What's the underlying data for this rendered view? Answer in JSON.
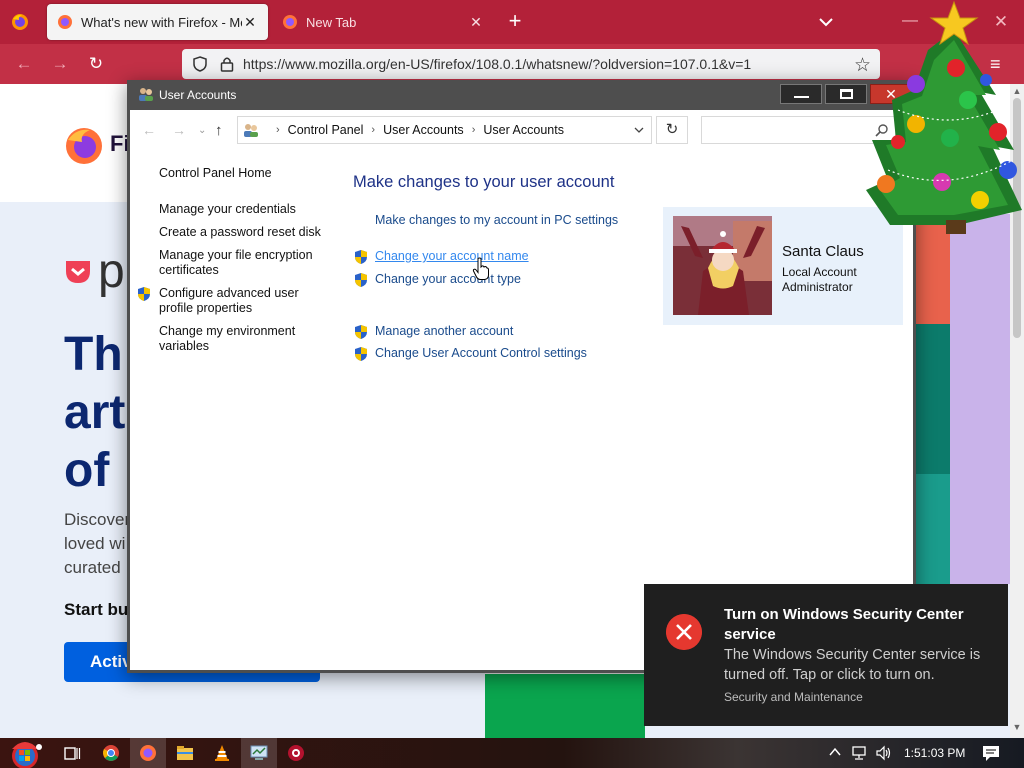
{
  "firefox": {
    "tabs": [
      {
        "title": "What's new with Firefox - More",
        "active": true
      },
      {
        "title": "New Tab",
        "active": false
      }
    ],
    "url": "https://www.mozilla.org/en-US/firefox/108.0.1/whatsnew/?oldversion=107.0.1&v=1",
    "page": {
      "logo_text": "Fi",
      "pocket_text": "p",
      "hero_lines": [
        "Th",
        "art",
        "of"
      ],
      "disc_lines": [
        "Discover",
        "loved wi",
        "curated "
      ],
      "start_text": "Start bu",
      "activate_label": "Activ"
    }
  },
  "user_accounts": {
    "window_title": "User Accounts",
    "breadcrumb": [
      "Control Panel",
      "User Accounts",
      "User Accounts"
    ],
    "left_links": [
      "Control Panel Home",
      "Manage your credentials",
      "Create a password reset disk",
      "Manage your file encryption certificates",
      "Configure advanced user profile properties",
      "Change my environment variables"
    ],
    "heading": "Make changes to your user account",
    "tasks": [
      "Make changes to my account in PC settings",
      "Change your account name",
      "Change your account type",
      "Manage another account",
      "Change User Account Control settings"
    ],
    "account": {
      "name": "Santa Claus",
      "type": "Local Account",
      "role": "Administrator"
    }
  },
  "toast": {
    "title": "Turn on Windows Security Center service",
    "body": "The Windows Security Center service is turned off. Tap or click to turn on.",
    "source": "Security and Maintenance"
  },
  "taskbar": {
    "clock": "1:51:03 PM"
  },
  "colors": {
    "firefox_tabbar": "#b32139",
    "firefox_navbar": "#c23046",
    "link_blue": "#1a4b8c",
    "heading_blue": "#1e3287",
    "toast_error": "#e5382f"
  }
}
